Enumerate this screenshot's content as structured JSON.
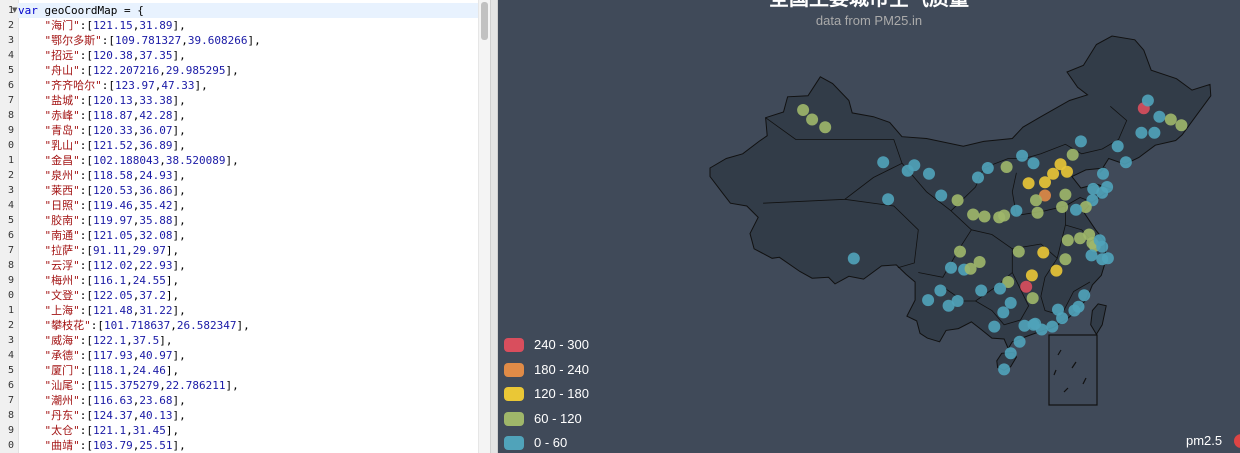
{
  "editor": {
    "lines": [
      {
        "n": "1",
        "fold": true,
        "key": "",
        "x": "",
        "y": "",
        "text": "var geoCoordMap = {"
      },
      {
        "n": "2",
        "key": "海门",
        "x": "121.15",
        "y": "31.89"
      },
      {
        "n": "3",
        "key": "鄂尔多斯",
        "x": "109.781327",
        "y": "39.608266"
      },
      {
        "n": "4",
        "key": "招远",
        "x": "120.38",
        "y": "37.35"
      },
      {
        "n": "5",
        "key": "舟山",
        "x": "122.207216",
        "y": "29.985295"
      },
      {
        "n": "6",
        "key": "齐齐哈尔",
        "x": "123.97",
        "y": "47.33"
      },
      {
        "n": "7",
        "key": "盐城",
        "x": "120.13",
        "y": "33.38"
      },
      {
        "n": "8",
        "key": "赤峰",
        "x": "118.87",
        "y": "42.28"
      },
      {
        "n": "9",
        "key": "青岛",
        "x": "120.33",
        "y": "36.07"
      },
      {
        "n": "0",
        "key": "乳山",
        "x": "121.52",
        "y": "36.89"
      },
      {
        "n": "1",
        "key": "金昌",
        "x": "102.188043",
        "y": "38.520089"
      },
      {
        "n": "2",
        "key": "泉州",
        "x": "118.58",
        "y": "24.93"
      },
      {
        "n": "3",
        "key": "莱西",
        "x": "120.53",
        "y": "36.86"
      },
      {
        "n": "4",
        "key": "日照",
        "x": "119.46",
        "y": "35.42"
      },
      {
        "n": "5",
        "key": "胶南",
        "x": "119.97",
        "y": "35.88"
      },
      {
        "n": "6",
        "key": "南通",
        "x": "121.05",
        "y": "32.08"
      },
      {
        "n": "7",
        "key": "拉萨",
        "x": "91.11",
        "y": "29.97"
      },
      {
        "n": "8",
        "key": "云浮",
        "x": "112.02",
        "y": "22.93"
      },
      {
        "n": "9",
        "key": "梅州",
        "x": "116.1",
        "y": "24.55"
      },
      {
        "n": "0",
        "key": "文登",
        "x": "122.05",
        "y": "37.2"
      },
      {
        "n": "1",
        "key": "上海",
        "x": "121.48",
        "y": "31.22"
      },
      {
        "n": "2",
        "key": "攀枝花",
        "x": "101.718637",
        "y": "26.582347"
      },
      {
        "n": "3",
        "key": "威海",
        "x": "122.1",
        "y": "37.5"
      },
      {
        "n": "4",
        "key": "承德",
        "x": "117.93",
        "y": "40.97"
      },
      {
        "n": "5",
        "key": "厦门",
        "x": "118.1",
        "y": "24.46"
      },
      {
        "n": "6",
        "key": "汕尾",
        "x": "115.375279",
        "y": "22.786211"
      },
      {
        "n": "7",
        "key": "潮州",
        "x": "116.63",
        "y": "23.68"
      },
      {
        "n": "8",
        "key": "丹东",
        "x": "124.37",
        "y": "40.13"
      },
      {
        "n": "9",
        "key": "太仓",
        "x": "121.1",
        "y": "31.45"
      },
      {
        "n": "0",
        "key": "曲靖",
        "x": "103.79",
        "y": "25.51"
      }
    ]
  },
  "chart": {
    "title": "全国主要城市空气质量",
    "subtitle": "data from PM25.in",
    "series_name": "pm2.5",
    "series_color": "#dd4444",
    "background": "#404a59",
    "legend": [
      {
        "label": "240 - 300",
        "color": "#d94e5d"
      },
      {
        "label": "180 - 240",
        "color": "#e08b47"
      },
      {
        "label": "120 - 180",
        "color": "#eac736"
      },
      {
        "label": "60 - 120",
        "color": "#9fb76a"
      },
      {
        "label": "0 - 60",
        "color": "#50a3ba"
      }
    ]
  },
  "chart_data": {
    "type": "scatter",
    "title": "全国主要城市空气质量",
    "subtitle": "data from PM25.in",
    "xlabel": "",
    "ylabel": "",
    "xlim": [
      73,
      136
    ],
    "ylim": [
      17,
      54
    ],
    "legend_position": "bottom-left",
    "points": [
      {
        "x": 126.6,
        "y": 45.8,
        "v": 250
      },
      {
        "x": 128.5,
        "y": 44.9,
        "v": 40
      },
      {
        "x": 127.1,
        "y": 46.6,
        "v": 40
      },
      {
        "x": 129.9,
        "y": 44.6,
        "v": 80
      },
      {
        "x": 131.2,
        "y": 44.0,
        "v": 90
      },
      {
        "x": 126.3,
        "y": 43.2,
        "v": 40
      },
      {
        "x": 127.9,
        "y": 43.2,
        "v": 40
      },
      {
        "x": 87.6,
        "y": 43.8,
        "v": 80
      },
      {
        "x": 86.0,
        "y": 44.6,
        "v": 90
      },
      {
        "x": 84.9,
        "y": 45.6,
        "v": 100
      },
      {
        "x": 94.7,
        "y": 40.1,
        "v": 40
      },
      {
        "x": 97.7,
        "y": 39.2,
        "v": 40
      },
      {
        "x": 98.5,
        "y": 39.8,
        "v": 40
      },
      {
        "x": 101.8,
        "y": 36.6,
        "v": 40
      },
      {
        "x": 95.3,
        "y": 36.2,
        "v": 40
      },
      {
        "x": 91.1,
        "y": 29.97,
        "v": 40
      },
      {
        "x": 100.3,
        "y": 38.9,
        "v": 40
      },
      {
        "x": 106.3,
        "y": 38.5,
        "v": 40
      },
      {
        "x": 107.5,
        "y": 39.5,
        "v": 40
      },
      {
        "x": 109.8,
        "y": 39.6,
        "v": 80
      },
      {
        "x": 111.7,
        "y": 40.8,
        "v": 40
      },
      {
        "x": 113.1,
        "y": 40.0,
        "v": 40
      },
      {
        "x": 116.4,
        "y": 39.9,
        "v": 150
      },
      {
        "x": 117.2,
        "y": 39.1,
        "v": 130
      },
      {
        "x": 117.9,
        "y": 40.9,
        "v": 80
      },
      {
        "x": 118.9,
        "y": 42.3,
        "v": 40
      },
      {
        "x": 121.6,
        "y": 38.9,
        "v": 40
      },
      {
        "x": 123.4,
        "y": 41.8,
        "v": 40
      },
      {
        "x": 124.4,
        "y": 40.1,
        "v": 40
      },
      {
        "x": 120.4,
        "y": 37.3,
        "v": 40
      },
      {
        "x": 121.5,
        "y": 36.9,
        "v": 40
      },
      {
        "x": 122.1,
        "y": 37.5,
        "v": 40
      },
      {
        "x": 120.3,
        "y": 36.1,
        "v": 40
      },
      {
        "x": 119.5,
        "y": 35.4,
        "v": 80
      },
      {
        "x": 114.5,
        "y": 38.0,
        "v": 170
      },
      {
        "x": 115.5,
        "y": 38.9,
        "v": 150
      },
      {
        "x": 114.5,
        "y": 36.6,
        "v": 190
      },
      {
        "x": 112.5,
        "y": 37.9,
        "v": 120
      },
      {
        "x": 113.6,
        "y": 34.8,
        "v": 100
      },
      {
        "x": 113.4,
        "y": 36.1,
        "v": 80
      },
      {
        "x": 117.0,
        "y": 36.7,
        "v": 100
      },
      {
        "x": 116.6,
        "y": 35.4,
        "v": 90
      },
      {
        "x": 118.3,
        "y": 35.1,
        "v": 40
      },
      {
        "x": 108.9,
        "y": 34.3,
        "v": 80
      },
      {
        "x": 107.1,
        "y": 34.4,
        "v": 80
      },
      {
        "x": 109.5,
        "y": 34.5,
        "v": 100
      },
      {
        "x": 111.0,
        "y": 35.0,
        "v": 40
      },
      {
        "x": 103.8,
        "y": 36.1,
        "v": 80
      },
      {
        "x": 105.7,
        "y": 34.6,
        "v": 80
      },
      {
        "x": 117.3,
        "y": 31.9,
        "v": 90
      },
      {
        "x": 118.8,
        "y": 32.1,
        "v": 80
      },
      {
        "x": 119.9,
        "y": 32.5,
        "v": 100
      },
      {
        "x": 120.3,
        "y": 31.6,
        "v": 80
      },
      {
        "x": 120.6,
        "y": 31.3,
        "v": 90
      },
      {
        "x": 121.5,
        "y": 31.2,
        "v": 40
      },
      {
        "x": 121.2,
        "y": 31.9,
        "v": 40
      },
      {
        "x": 120.2,
        "y": 30.3,
        "v": 40
      },
      {
        "x": 122.2,
        "y": 30.0,
        "v": 40
      },
      {
        "x": 121.5,
        "y": 29.9,
        "v": 40
      },
      {
        "x": 114.3,
        "y": 30.6,
        "v": 140
      },
      {
        "x": 112.9,
        "y": 28.2,
        "v": 120
      },
      {
        "x": 113.0,
        "y": 25.8,
        "v": 110
      },
      {
        "x": 115.9,
        "y": 28.7,
        "v": 160
      },
      {
        "x": 117.0,
        "y": 29.9,
        "v": 90
      },
      {
        "x": 111.3,
        "y": 30.7,
        "v": 80
      },
      {
        "x": 110.0,
        "y": 27.5,
        "v": 80
      },
      {
        "x": 109.0,
        "y": 26.8,
        "v": 40
      },
      {
        "x": 112.2,
        "y": 27.0,
        "v": 250
      },
      {
        "x": 104.1,
        "y": 30.7,
        "v": 90
      },
      {
        "x": 106.5,
        "y": 29.6,
        "v": 80
      },
      {
        "x": 103.0,
        "y": 29.0,
        "v": 40
      },
      {
        "x": 104.6,
        "y": 28.8,
        "v": 40
      },
      {
        "x": 105.4,
        "y": 28.9,
        "v": 90
      },
      {
        "x": 106.7,
        "y": 26.6,
        "v": 40
      },
      {
        "x": 102.7,
        "y": 25.0,
        "v": 40
      },
      {
        "x": 103.8,
        "y": 25.5,
        "v": 40
      },
      {
        "x": 101.7,
        "y": 26.6,
        "v": 40
      },
      {
        "x": 100.2,
        "y": 25.6,
        "v": 40
      },
      {
        "x": 108.3,
        "y": 22.8,
        "v": 40
      },
      {
        "x": 110.3,
        "y": 25.3,
        "v": 40
      },
      {
        "x": 109.4,
        "y": 24.3,
        "v": 40
      },
      {
        "x": 113.3,
        "y": 23.1,
        "v": 40
      },
      {
        "x": 114.1,
        "y": 22.5,
        "v": 40
      },
      {
        "x": 113.1,
        "y": 23.0,
        "v": 40
      },
      {
        "x": 112.0,
        "y": 22.9,
        "v": 40
      },
      {
        "x": 116.1,
        "y": 24.6,
        "v": 40
      },
      {
        "x": 116.6,
        "y": 23.7,
        "v": 40
      },
      {
        "x": 115.4,
        "y": 22.8,
        "v": 40
      },
      {
        "x": 118.1,
        "y": 24.5,
        "v": 40
      },
      {
        "x": 118.6,
        "y": 24.9,
        "v": 40
      },
      {
        "x": 119.3,
        "y": 26.1,
        "v": 40
      },
      {
        "x": 110.3,
        "y": 20.0,
        "v": 40
      },
      {
        "x": 109.5,
        "y": 18.3,
        "v": 40
      },
      {
        "x": 111.4,
        "y": 21.2,
        "v": 40
      }
    ]
  },
  "palette": {
    "keyword": "#0000cc",
    "string": "#a31515",
    "number": "#1a1aa6",
    "map_fill": "#323c48",
    "map_border": "#111111"
  }
}
